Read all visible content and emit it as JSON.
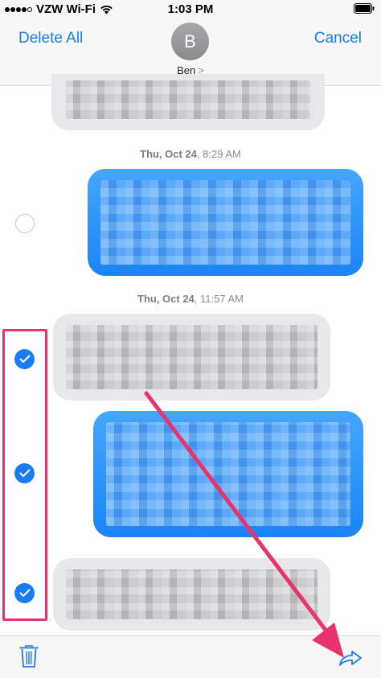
{
  "status_bar": {
    "carrier": "VZW Wi-Fi",
    "time": "1:03 PM",
    "icons": [
      "signal-dots-icon",
      "wifi-icon",
      "battery-icon"
    ]
  },
  "header": {
    "delete_all_label": "Delete All",
    "cancel_label": "Cancel",
    "avatar_initial": "B",
    "contact_name": "Ben",
    "contact_chevron": ">"
  },
  "conversation": {
    "timestamps": [
      {
        "day": "Thu, Oct 24",
        "time": "8:29 AM"
      },
      {
        "day": "Thu, Oct 24",
        "time": "11:57 AM"
      }
    ],
    "messages": [
      {
        "sender": "contact",
        "color": "gray",
        "content": "blurred",
        "selected": null
      },
      {
        "sender": "me",
        "color": "blue",
        "content": "blurred",
        "selected": false
      },
      {
        "sender": "contact",
        "color": "gray",
        "content": "blurred",
        "selected": true
      },
      {
        "sender": "me",
        "color": "blue",
        "content": "blurred",
        "selected": true
      },
      {
        "sender": "contact",
        "color": "gray",
        "content": "blurred",
        "selected": true
      }
    ]
  },
  "toolbar": {
    "left_icon": "trash-icon",
    "right_icon": "share-forward-icon"
  },
  "annotations": {
    "highlight_color": "#e8336d",
    "arrow_target": "share-forward-button"
  },
  "colors": {
    "accent": "#1a7cf5",
    "sent_bubble": "#2a8ef7",
    "received_bubble": "#e8e8ea"
  }
}
